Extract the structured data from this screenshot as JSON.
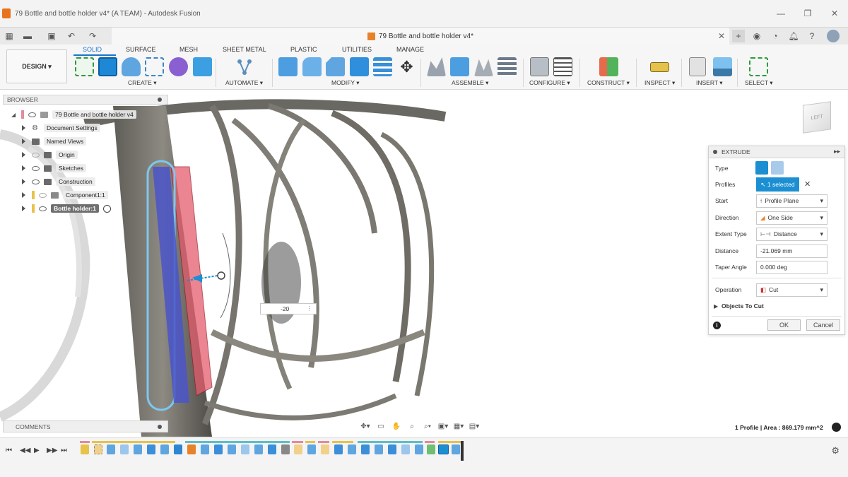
{
  "window": {
    "title": "79 Bottle and bottle holder v4* (A TEAM) - Autodesk Fusion",
    "doc_tab": "79 Bottle and bottle holder v4*"
  },
  "ribbon": {
    "workspace": "DESIGN",
    "tabs": [
      "SOLID",
      "SURFACE",
      "MESH",
      "SHEET METAL",
      "PLASTIC",
      "UTILITIES",
      "MANAGE"
    ],
    "active_tab": "SOLID",
    "groups": [
      "CREATE ▾",
      "AUTOMATE ▾",
      "MODIFY ▾",
      "ASSEMBLE ▾",
      "CONFIGURE ▾",
      "CONSTRUCT ▾",
      "INSPECT ▾",
      "INSERT ▾",
      "SELECT ▾"
    ]
  },
  "browser": {
    "title": "BROWSER",
    "root": "79 Bottle and bottle holder v4",
    "nodes": [
      "Document Settings",
      "Named Views",
      "Origin",
      "Sketches",
      "Construction",
      "Component1:1",
      "Bottle holder:1"
    ]
  },
  "comments": {
    "title": "COMMENTS"
  },
  "viewport": {
    "distance_input": "-20",
    "status": "1 Profile | Area : 869.179 mm^2",
    "viewcube_face": "LEFT"
  },
  "extrude": {
    "title": "EXTRUDE",
    "fields": {
      "type": "Type",
      "profiles": "Profiles",
      "start": "Start",
      "direction": "Direction",
      "extent_type": "Extent Type",
      "distance": "Distance",
      "taper_angle": "Taper Angle",
      "operation": "Operation",
      "objects_to_cut": "Objects To Cut"
    },
    "values": {
      "profiles": "1 selected",
      "start": "Profile Plane",
      "direction": "One Side",
      "extent_type": "Distance",
      "distance": "-21.069 mm",
      "taper_angle": "0.000 deg",
      "operation": "Cut"
    },
    "buttons": {
      "ok": "OK",
      "cancel": "Cancel"
    }
  },
  "colors": {
    "accent": "#1b8fd2",
    "cut_preview": "#e35d6d",
    "profile_selected": "#4a55c9"
  }
}
